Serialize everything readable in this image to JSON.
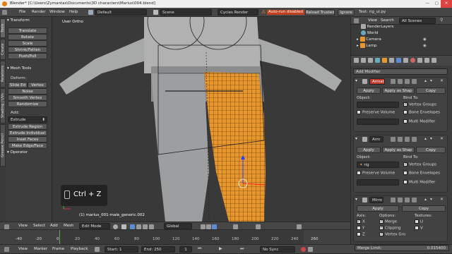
{
  "window_title": "Blender* [C:\\Users\\Zymantas\\Documents\\3D characters\\Marius\\004.blend]",
  "menu": [
    "File",
    "Render",
    "Window",
    "Help"
  ],
  "layout_name": "Default",
  "scene_name": "Scene",
  "render_engine": "Cycles Render",
  "autorun_warning": "Auto-run disabled",
  "reload_trusted": "Reload Trusted",
  "ignore": "Ignore",
  "text_file": "Text: rig_ui.py",
  "viewport_label": "User Ortho",
  "object_label": "(1) marius_001-male_generic.002",
  "shortcut": {
    "key": "Ctrl + Z"
  },
  "tool_shelf": {
    "transform_header": "Transform",
    "transform_buttons": [
      "Translate",
      "Rotate",
      "Scale",
      "Shrink/Fatten",
      "Push/Pull"
    ],
    "mesh_tools_header": "Mesh Tools",
    "deform_label": "Deform:",
    "slide_edge": "Slide Ed",
    "vertex": "Vertex",
    "deform_buttons": [
      "Noise",
      "Smooth Vertex",
      "Randomize"
    ],
    "add_label": "Add:",
    "extrude": "Extrude",
    "add_buttons": [
      "Extrude Region",
      "Extrude Individual",
      "Inset Faces",
      "Make Edge/Face"
    ],
    "operator_header": "Operator",
    "side_tabs": [
      "Tools",
      "Create",
      "Relations",
      "Shading / UVs",
      "Grease Pencil"
    ]
  },
  "outliner": {
    "view": "View",
    "search": "Search",
    "scope": "All Scenes",
    "items": [
      "RenderLayers",
      "World",
      "Camera",
      "Lamp"
    ]
  },
  "properties": {
    "add_modifier": "Add Modifier",
    "modifiers": [
      {
        "name": "Armat",
        "apply": "Apply",
        "apply_as": "Apply as Shap",
        "copy": "Copy",
        "object_label": "Object:",
        "bind_label": "Bind To:",
        "object_value": "",
        "vertex_groups": "Vertex Groups",
        "preserve_volume": "Preserve Volume",
        "bone_envelopes": "Bone Envelopes",
        "multi_modifier": "Multi Modifier"
      },
      {
        "name": "Arm",
        "apply": "Apply",
        "apply_as": "Apply as Shap",
        "copy": "Copy",
        "object_label": "Object:",
        "bind_label": "Bind To:",
        "object_value": "rig",
        "vertex_groups": "Vertex Groups",
        "preserve_volume": "Preserve Volume",
        "bone_envelopes": "Bone Envelopes",
        "multi_modifier": "Multi Modifier"
      }
    ],
    "mirror": {
      "name": "Mirro",
      "apply": "Apply",
      "copy": "Copy",
      "axis_label": "Axis:",
      "options_label": "Options:",
      "textures_label": "Textures:",
      "axes": [
        "X",
        "Y",
        "Z"
      ],
      "options": [
        "Merge",
        "Clipping",
        "Vertex Gro"
      ],
      "textures": [
        "U",
        "V"
      ],
      "merge_limit_label": "Merge Limit:",
      "merge_limit_value": "0.015400"
    }
  },
  "viewport_header": {
    "view": "View",
    "select": "Select",
    "add": "Add",
    "mesh": "Mesh",
    "mode": "Edit Mode",
    "pivot": "Global"
  },
  "timeline": {
    "ticks": [
      "-40",
      "-20",
      "0",
      "20",
      "40",
      "60",
      "80",
      "100",
      "120",
      "140",
      "160",
      "180",
      "200",
      "220",
      "240",
      "260"
    ],
    "view": "View",
    "marker": "Marker",
    "frame": "Frame",
    "playback": "Playback",
    "start_label": "Start:",
    "start": "1",
    "end_label": "End:",
    "end": "250",
    "current": "1",
    "sync": "No Sync"
  },
  "colors": {
    "accent": "#f0a030",
    "selected": "#ff8c00",
    "header": "#464646",
    "panel": "#3c3c3c"
  }
}
